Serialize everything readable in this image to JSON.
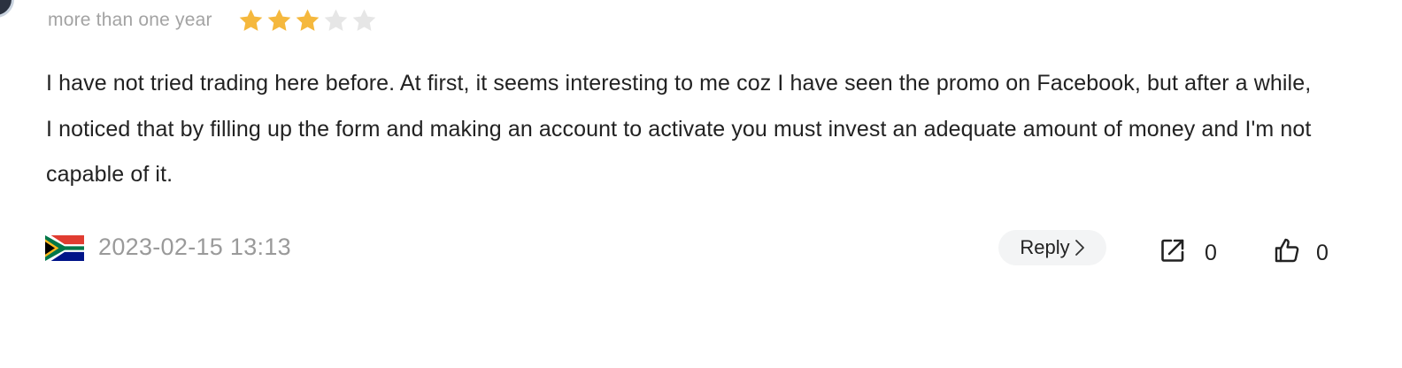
{
  "review": {
    "duration": "more than one year",
    "rating": 3,
    "max_rating": 5,
    "body": "I have not tried trading here before. At first, it seems interesting to me coz I have seen the promo on Facebook, but after a while, I noticed that by filling up the form and making an account to activate you must invest an adequate amount of money and I'm not capable of it.",
    "timestamp": "2023-02-15 13:13",
    "country_flag": "south-africa-flag"
  },
  "actions": {
    "reply_label": "Reply",
    "reply_icon": "chevron-right-icon",
    "share_icon": "share-external-icon",
    "share_count": "0",
    "like_icon": "thumbs-up-icon",
    "like_count": "0"
  },
  "colors": {
    "star_filled": "#F5B83D",
    "star_empty": "#E6E6E6",
    "meta_text": "#A3A3A3",
    "body_text": "#222222",
    "reply_bg": "#F3F4F5"
  }
}
